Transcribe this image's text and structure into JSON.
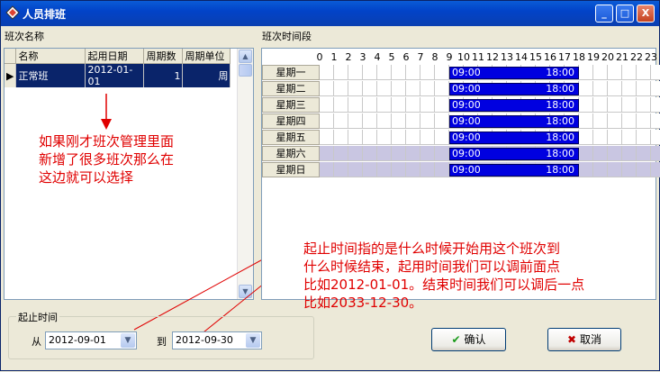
{
  "window": {
    "title": "人员排班",
    "minimize": "_",
    "maximize": "□",
    "close": "X"
  },
  "left_panel": {
    "label": "班次名称",
    "columns": [
      "名称",
      "起用日期",
      "周期数",
      "周期单位"
    ],
    "rows": [
      {
        "name": "正常班",
        "start_date": "2012-01-01",
        "cycles": "1",
        "unit": "周"
      }
    ]
  },
  "right_panel": {
    "label": "班次时间段",
    "hours": [
      "0",
      "1",
      "2",
      "3",
      "4",
      "5",
      "6",
      "7",
      "8",
      "9",
      "10",
      "11",
      "12",
      "13",
      "14",
      "15",
      "16",
      "17",
      "18",
      "19",
      "20",
      "21",
      "22",
      "23",
      "24"
    ],
    "days": [
      {
        "label": "星期一",
        "start": "09:00",
        "end": "18:00",
        "weekend": false
      },
      {
        "label": "星期二",
        "start": "09:00",
        "end": "18:00",
        "weekend": false
      },
      {
        "label": "星期三",
        "start": "09:00",
        "end": "18:00",
        "weekend": false
      },
      {
        "label": "星期四",
        "start": "09:00",
        "end": "18:00",
        "weekend": false
      },
      {
        "label": "星期五",
        "start": "09:00",
        "end": "18:00",
        "weekend": false
      },
      {
        "label": "星期六",
        "start": "09:00",
        "end": "18:00",
        "weekend": true
      },
      {
        "label": "星期日",
        "start": "09:00",
        "end": "18:00",
        "weekend": true
      }
    ],
    "shift_start_hour": 9,
    "shift_end_hour": 18
  },
  "annotations": {
    "left_lines": [
      "如果刚才班次管理里面",
      "新增了很多班次那么在",
      "这边就可以选择"
    ],
    "right_lines": [
      "起止时间指的是什么时候开始用这个班次到",
      "什么时候结束，起用时间我们可以调前面点",
      "比如2012-01-01。结束时间我们可以调后一点",
      "比如2033-12-30。"
    ]
  },
  "period": {
    "legend": "起止时间",
    "from_label": "从",
    "from_value": "2012-09-01",
    "to_label": "到",
    "to_value": "2012-09-30"
  },
  "buttons": {
    "ok": "确认",
    "cancel": "取消"
  },
  "colors": {
    "title_bar": "#0a4bd0",
    "shift_bar": "#0000e0",
    "selection": "#0a246a",
    "weekend_cell": "#c9c6e2",
    "annotation": "#e00000"
  }
}
